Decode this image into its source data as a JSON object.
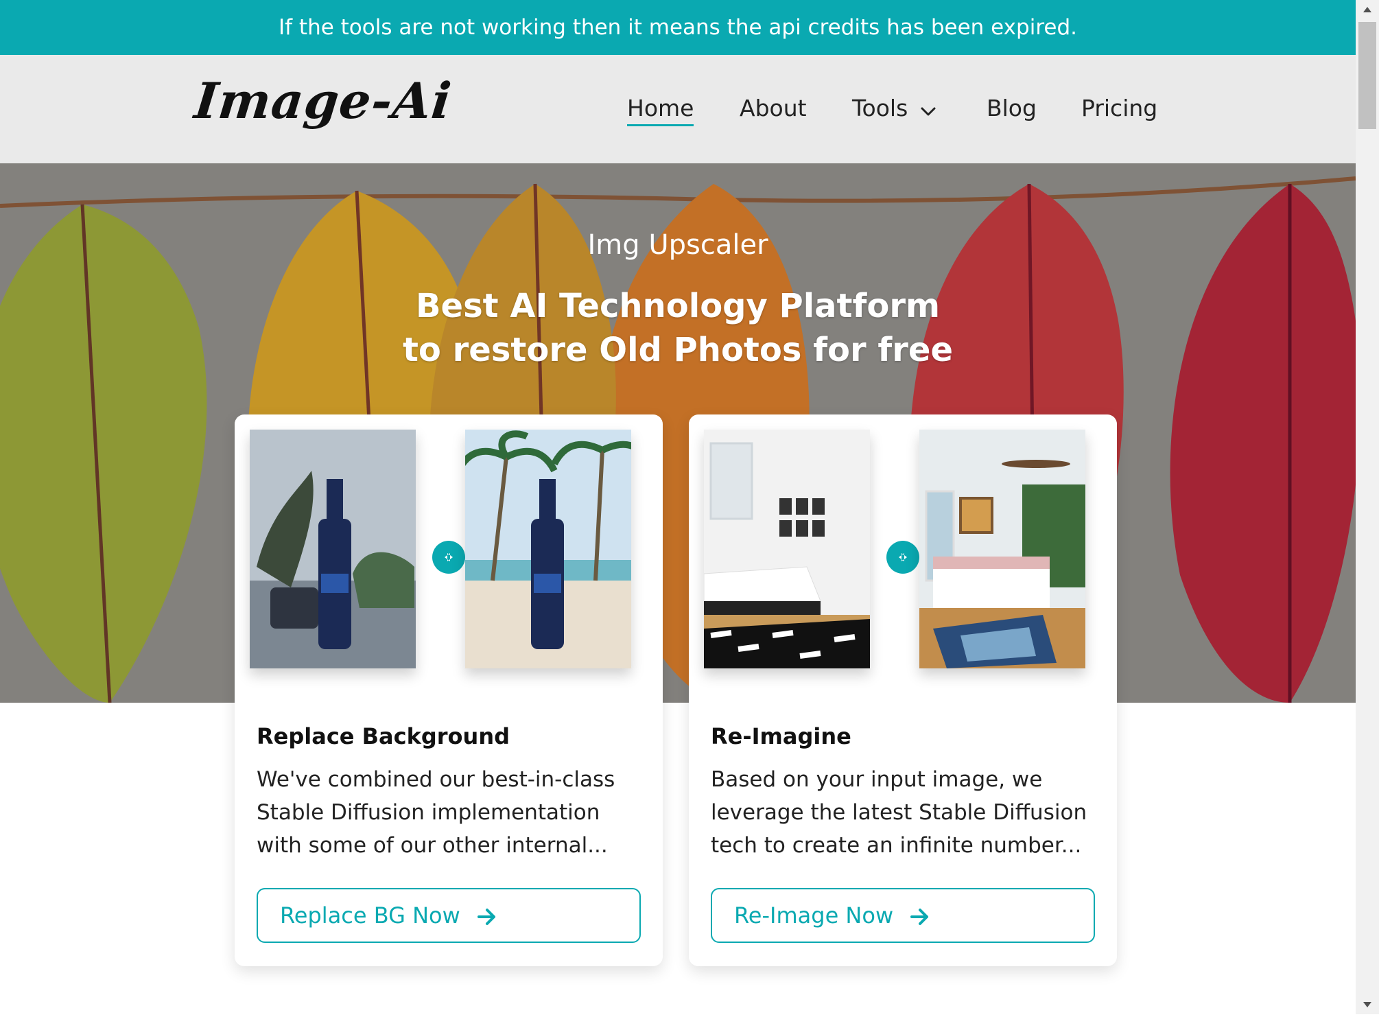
{
  "notice": {
    "text": "If the tools are not working then it means the api credits has been expired."
  },
  "header": {
    "logo": "Image-Ai",
    "nav": [
      {
        "label": "Home",
        "active": true
      },
      {
        "label": "About",
        "active": false
      },
      {
        "label": "Tools",
        "active": false,
        "dropdown": true
      },
      {
        "label": "Blog",
        "active": false
      },
      {
        "label": "Pricing",
        "active": false
      }
    ]
  },
  "hero": {
    "subtitle": "Img Upscaler",
    "title_line1": "Best AI Technology Platform",
    "title_line2": "to restore Old Photos for free"
  },
  "cards": [
    {
      "title": "Replace Background",
      "description": "We've combined our best-in-class Stable Diffusion implementation with some of our other internal...",
      "button": "Replace BG Now",
      "icons": [
        "before-image-bottle",
        "swap-icon",
        "after-image-bottle-beach",
        "arrow-right-icon"
      ]
    },
    {
      "title": "Re-Imagine",
      "description": "Based on your input image, we leverage the latest Stable Diffusion tech to create an infinite number...",
      "button": "Re-Image Now",
      "icons": [
        "before-image-bedroom",
        "swap-icon",
        "after-image-bedroom-green",
        "arrow-right-icon"
      ]
    }
  ],
  "colors": {
    "accent": "#0aa9b1",
    "header_bg": "#eaeaea",
    "notice_bg": "#0aa9b1"
  }
}
